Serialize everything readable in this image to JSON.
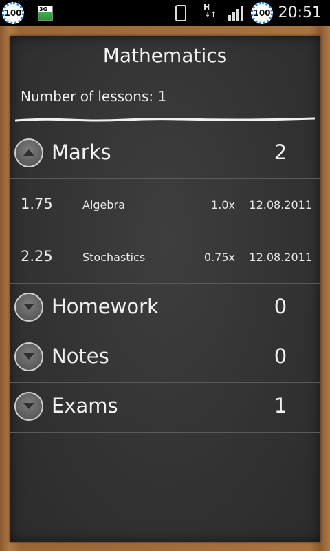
{
  "status_bar": {
    "badge_left": "100",
    "network_type": "3G",
    "hspa_label": "H",
    "hspa_arrows": "↓↑",
    "badge_right": "100",
    "time": "20:51"
  },
  "page": {
    "title": "Mathematics",
    "lessons_label": "Number of lessons: 1"
  },
  "sections": [
    {
      "label": "Marks",
      "count": "2",
      "expanded": true
    },
    {
      "label": "Homework",
      "count": "0",
      "expanded": false
    },
    {
      "label": "Notes",
      "count": "0",
      "expanded": false
    },
    {
      "label": "Exams",
      "count": "1",
      "expanded": false
    }
  ],
  "marks": [
    {
      "value": "1.75",
      "name": "Algebra",
      "weight": "1.0x",
      "date": "12.08.2011"
    },
    {
      "value": "2.25",
      "name": "Stochastics",
      "weight": "0.75x",
      "date": "12.08.2011"
    }
  ],
  "colors": {
    "board": "#333333",
    "wood": "#a8733f",
    "chalk": "#f2f2f2",
    "badge_ring": "#2a8fe0"
  }
}
